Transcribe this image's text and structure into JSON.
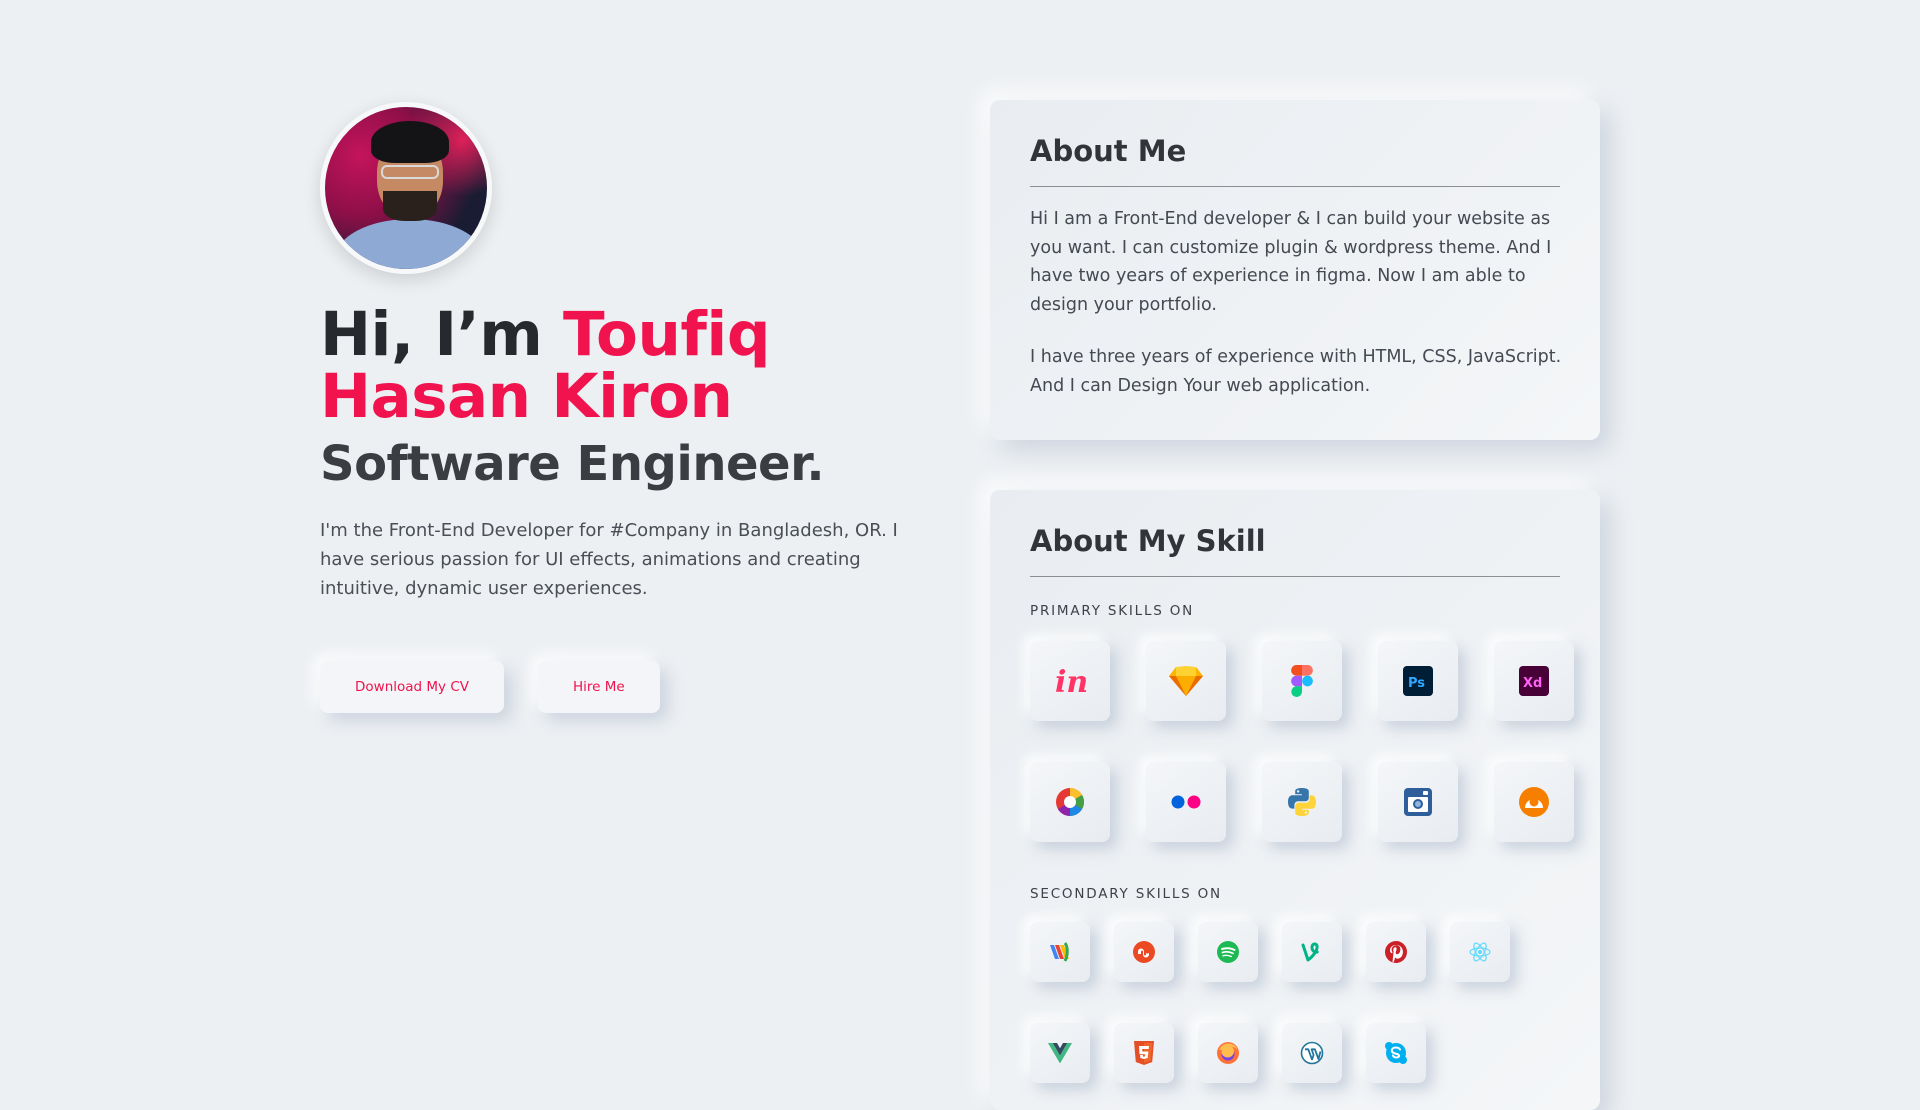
{
  "hero": {
    "greeting": "Hi, I’m ",
    "name_part1": "Toufiq",
    "name_part2": "Hasan Kiron",
    "role": "Software Engineer.",
    "intro": "I'm the Front-End Developer for #Company in Bangladesh, OR. I have serious passion for UI effects, animations and creating intuitive, dynamic user experiences.",
    "buttons": {
      "download_cv": "Download My CV",
      "hire_me": "Hire Me"
    }
  },
  "about": {
    "title": "About Me",
    "paragraph1": "Hi I am a Front-End developer & I can build your website as you want. I can customize plugin & wordpress theme. And I have two years of experience in figma. Now I am able to design your portfolio.",
    "paragraph2": "I have three years of experience with HTML, CSS, JavaScript. And I can Design Your web application."
  },
  "skills": {
    "title": "About My Skill",
    "primary_label": "PRIMARY SKILLS ON",
    "secondary_label": "SECONDARY SKILLS ON",
    "primary_icons": [
      "invision-icon",
      "sketch-icon",
      "figma-icon",
      "photoshop-icon",
      "adobe-xd-icon",
      "picasa-icon",
      "flickr-icon",
      "python-icon",
      "instagram-icon",
      "grooveshark-icon"
    ],
    "secondary_icons": [
      "google-wallet-icon",
      "stumbleupon-icon",
      "spotify-icon",
      "vine-icon",
      "pinterest-icon",
      "react-icon",
      "vuejs-icon",
      "html5-icon",
      "firefox-icon",
      "wordpress-icon",
      "skype-icon"
    ]
  },
  "colors": {
    "background": "#edf0f3",
    "accent": "#f0134d",
    "heading": "#26292e"
  }
}
